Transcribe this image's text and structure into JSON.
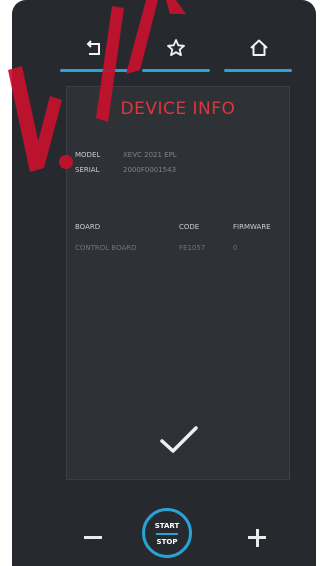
{
  "colors": {
    "frame": "#262a2e",
    "panel": "#2e3236",
    "accent": "#29a3d6",
    "title": "#e0343c",
    "text_dim": "#8a8e93",
    "icon": "#f2f2f2",
    "watermark": "#c8102e"
  },
  "nav": {
    "items": [
      {
        "icon": "back-icon"
      },
      {
        "icon": "favorite-star-icon"
      },
      {
        "icon": "home-icon"
      }
    ]
  },
  "panel": {
    "title": "DEVICE INFO",
    "model_label": "MODEL",
    "model_value": "XEVC 2021 EPL",
    "serial_label": "SERIAL",
    "serial_value": "2000F0001543",
    "table": {
      "headers": [
        "BOARD",
        "CODE",
        "FIRMWARE"
      ],
      "rows": [
        [
          "CONTROL BOARD",
          "FE1057",
          "0"
        ]
      ]
    },
    "confirm_icon": "checkmark-icon"
  },
  "bottom": {
    "minus_icon": "minus-icon",
    "plus_icon": "plus-icon",
    "start_label": "START",
    "stop_label": "STOP"
  }
}
